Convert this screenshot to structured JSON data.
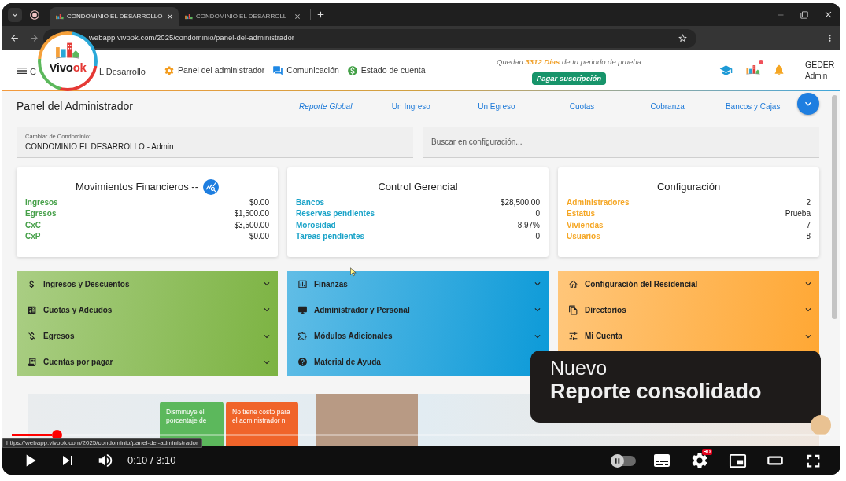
{
  "browser": {
    "tabs": [
      {
        "title": "CONDOMINIO EL DESARROLLO",
        "selected": true
      },
      {
        "title": "CONDOMINIO EL DESARROLL",
        "selected": false
      }
    ],
    "url": "webapp.vivook.com/2025/condominio/panel-del-administrador"
  },
  "logo": {
    "wordmark": [
      "Vivo",
      "ok"
    ]
  },
  "header": {
    "title_fragments": [
      "C",
      "L Desarrollo"
    ],
    "nav": [
      "Panel del administrador",
      "Comunicación",
      "Estado de cuenta"
    ],
    "trial_notice": "Quedan **3312 Días** de tu periodo de prueba",
    "pay_button": "Pagar suscripción",
    "notification_dot": true,
    "user": {
      "name": "GEDER",
      "role": "Admin"
    }
  },
  "panel": {
    "title": "Panel del Administrador",
    "quick_links": [
      {
        "label": "Reporte Global",
        "kind": "report"
      },
      {
        "label": "Un Ingreso",
        "kind": "action"
      },
      {
        "label": "Un Egreso",
        "kind": "action"
      },
      {
        "label": "Cuotas",
        "kind": "action"
      },
      {
        "label": "Cobranza",
        "kind": "action"
      },
      {
        "label": "Bancos y Cajas",
        "kind": "action"
      }
    ],
    "condominio_field": {
      "label": "Cambiar de Condominio:",
      "value": "CONDOMINIO EL DESARROLLO - Admin"
    },
    "search": {
      "placeholder": "Buscar en configuración..."
    }
  },
  "summary_cards": [
    {
      "title": "Movimientos Financieros --",
      "color": "#46a049",
      "report_button": true,
      "rows": [
        {
          "label": "Ingresos",
          "value": "$0.00"
        },
        {
          "label": "Egresos",
          "value": "$1,500.00"
        },
        {
          "label": "CxC",
          "value": "$3,500.00"
        },
        {
          "label": "CxP",
          "value": "$0.00"
        }
      ]
    },
    {
      "title": "Control Gerencial",
      "color": "#1aa3c8",
      "report_button": false,
      "rows": [
        {
          "label": "Bancos",
          "value": "$28,500.00"
        },
        {
          "label": "Reservas pendientes",
          "value": "0"
        },
        {
          "label": "Morosidad",
          "value": "8.97%"
        },
        {
          "label": "Tareas pendientes",
          "value": "0"
        }
      ]
    },
    {
      "title": "Configuración",
      "color": "#f5a623",
      "report_button": false,
      "rows": [
        {
          "label": "Administradores",
          "value": "2"
        },
        {
          "label": "Estatus",
          "value": "Prueba"
        },
        {
          "label": "Viviendas",
          "value": "7"
        },
        {
          "label": "Usuarios",
          "value": "8"
        }
      ]
    }
  ],
  "menu_panels": [
    {
      "color": "#7cb342",
      "items": [
        {
          "label": "Ingresos y Descuentos",
          "kind": "expandable"
        },
        {
          "label": "Cuotas y Adeudos",
          "kind": "expandable"
        },
        {
          "label": "Egresos",
          "kind": "expandable"
        },
        {
          "label": "Cuentas por pagar",
          "kind": "expandable"
        }
      ]
    },
    {
      "color": "#0c9ad8",
      "items": [
        {
          "label": "Finanzas",
          "kind": "expandable"
        },
        {
          "label": "Administrador y Personal",
          "kind": "expandable"
        },
        {
          "label": "Módulos Adicionales",
          "kind": "expandable"
        },
        {
          "label": "Material de Ayuda",
          "kind": "link"
        }
      ]
    },
    {
      "color": "#ffa733",
      "items": [
        {
          "label": "Configuración del Residencial",
          "kind": "expandable"
        },
        {
          "label": "Directorios",
          "kind": "expandable"
        },
        {
          "label": "Mi Cuenta",
          "kind": "expandable"
        }
      ]
    }
  ],
  "promo": {
    "cards": [
      {
        "text": "Disminuye el porcentaje de",
        "color": "#5cb85c"
      },
      {
        "text": "No tiene costo para el administrador ni",
        "color": "#f0642a"
      }
    ]
  },
  "video_overlay": {
    "lines": [
      "Nuevo",
      "Reporte consolidado"
    ]
  },
  "link_preview": "https://webapp.vivook.com/2025/condominio/panel-del-administrador",
  "player": {
    "progress": {
      "level": 0.055
    },
    "time": "0:10 / 3:10",
    "autoplay": false,
    "quality_badge": "HD"
  }
}
